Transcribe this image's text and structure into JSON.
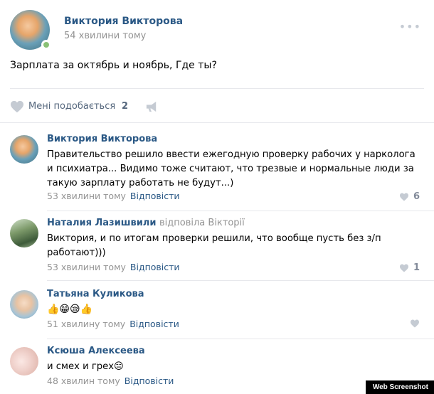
{
  "post": {
    "author": "Виктория Викторова",
    "time": "54 хвилини тому",
    "text": "Зарплата за октябрь и ноябрь, Где ты?",
    "like_label": "Мені подобається",
    "like_count": "2",
    "more_icon": "ellipsis-icon"
  },
  "comments": [
    {
      "author": "Виктория Викторова",
      "replied_to": "",
      "text": "Правительство решило ввести ежегодную проверку рабочих у нарколога и психиатра... Видимо тоже считают, что трезвые и нормальные люди за такую зарплату работать не будут...)",
      "time": "53 хвилини тому",
      "reply_label": "Відповісти",
      "likes": "6"
    },
    {
      "author": "Наталия Лазишвили",
      "replied_to": "відповіла Вікторії",
      "text": "Виктория, и по итогам проверки решили, что вообще пусть без з/п работают)))",
      "time": "53 хвилини тому",
      "reply_label": "Відповісти",
      "likes": "1"
    },
    {
      "author": "Татьяна Куликова",
      "replied_to": "",
      "text": "👍😁😪👍",
      "time": "51 хвилину тому",
      "reply_label": "Відповісти",
      "likes": ""
    },
    {
      "author": "Ксюша Алексеева",
      "replied_to": "",
      "text": "и смех и грех😑",
      "time": "48 хвилин тому",
      "reply_label": "Відповісти",
      "likes": ""
    }
  ],
  "watermark": "Web Screenshot",
  "colors": {
    "link": "#2a5885",
    "muted": "#939393",
    "online": "#8ac176",
    "icon": "#828a99"
  }
}
